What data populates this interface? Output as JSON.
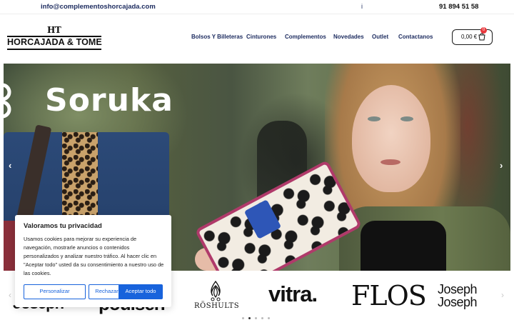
{
  "topbar": {
    "email": "info@complementoshorcajada.com",
    "separator": "i",
    "phone": "91 894 51 58"
  },
  "logo": {
    "monogram": "HT",
    "name": "HORCAJADA & TOME"
  },
  "nav": {
    "items": [
      "Bolsos Y Billeteras",
      "Cinturones",
      "Complementos",
      "Novedades",
      "Outlet",
      "Contactanos"
    ]
  },
  "cart": {
    "amount": "0,00 €",
    "count": "0",
    "icon": "basket-icon"
  },
  "hero": {
    "brand": "Soruka",
    "prev_icon": "chevron-left-icon",
    "next_icon": "chevron-right-icon"
  },
  "brands": {
    "logos": [
      "Joseph Joseph",
      "Poulsen",
      "RÖSHULTS",
      "vitra.",
      "FLOS",
      "Joseph Joseph"
    ],
    "rendered": {
      "josephA": "Joseph",
      "poulsen": "poulsen",
      "roshults": "RÖSHULTS",
      "vitra": "vitra.",
      "flos": "FLOS",
      "josephB1": "Joseph",
      "josephB2": "Joseph"
    },
    "slides_total": 5,
    "active_slide": 2
  },
  "cookie": {
    "title": "Valoramos tu privacidad",
    "body": "Usamos cookies para mejorar su experiencia de navegación, mostrarle anuncios o contenidos personalizados y analizar nuestro tráfico. Al hacer clic en \"Aceptar todo\" usted da su consentimiento a nuestro uso de las cookies.",
    "customize_label": "Personalizar",
    "reject_label": "Rechazar todo",
    "accept_label": "Aceptar todo",
    "accent_color": "#1863dc"
  }
}
